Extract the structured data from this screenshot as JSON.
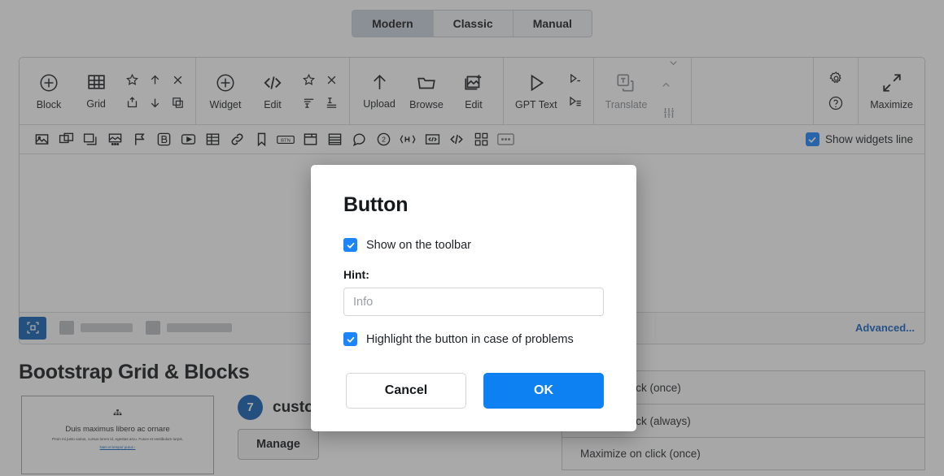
{
  "tabs": [
    {
      "label": "Modern",
      "active": true
    },
    {
      "label": "Classic",
      "active": false
    },
    {
      "label": "Manual",
      "active": false
    }
  ],
  "toolbar": {
    "groups": [
      {
        "name": "block-group",
        "buttons": [
          {
            "label": "Block",
            "icon": "plus-circle-icon"
          },
          {
            "label": "Grid",
            "icon": "grid-icon"
          }
        ],
        "mini": [
          {
            "icon": "star-icon",
            "disabled": false
          },
          {
            "icon": "arrow-up-icon",
            "disabled": false
          },
          {
            "icon": "close-x-icon",
            "disabled": false
          },
          {
            "icon": "insert-above-icon",
            "disabled": false
          },
          {
            "icon": "arrow-down-icon",
            "disabled": false
          },
          {
            "icon": "duplicate-icon",
            "disabled": false
          }
        ],
        "mini_cols": 3
      },
      {
        "name": "widget-group",
        "buttons": [
          {
            "label": "Widget",
            "icon": "plus-circle-icon"
          },
          {
            "label": "Edit",
            "icon": "code-icon"
          }
        ],
        "mini": [
          {
            "icon": "star-icon",
            "disabled": false
          },
          {
            "icon": "close-x-icon",
            "disabled": false
          },
          {
            "icon": "align-text-top-icon",
            "disabled": false
          },
          {
            "icon": "align-text-bottom-icon",
            "disabled": false
          }
        ],
        "mini_cols": 2
      },
      {
        "name": "image-group",
        "buttons": [
          {
            "label": "Upload",
            "icon": "upload-arrow-icon"
          },
          {
            "label": "Browse",
            "icon": "folder-icon"
          },
          {
            "label": "Edit",
            "icon": "image-edit-icon"
          }
        ],
        "mini": [],
        "mini_cols": 0
      },
      {
        "name": "gpt-group",
        "buttons": [
          {
            "label": "GPT Text",
            "icon": "play-triangle-icon"
          }
        ],
        "mini": [
          {
            "icon": "run-line-icon",
            "disabled": false
          },
          {
            "icon": "run-list-icon",
            "disabled": false
          }
        ],
        "mini_cols": 1
      },
      {
        "name": "translate-group",
        "buttons": [
          {
            "label": "Translate",
            "icon": "translate-icon",
            "disabled": true
          }
        ],
        "mini": [
          {
            "icon": "chevron-down-icon",
            "disabled": true
          },
          {
            "icon": "chevron-up-icon",
            "disabled": true
          },
          {
            "icon": "sliders-icon",
            "disabled": true
          }
        ],
        "mini_cols": 1
      }
    ],
    "right": {
      "settings_icon": "gear-icon",
      "help_icon": "question-circle-icon",
      "help_active": true,
      "maximize": {
        "label": "Maximize",
        "icon": "maximize-arrows-icon"
      }
    }
  },
  "widgets_line": {
    "icons": [
      "image-icon",
      "image-stack-icon",
      "image-multi-icon",
      "image-dots-icon",
      "flag-icon",
      "bold-box-icon",
      "video-play-icon",
      "table-icon",
      "link-icon",
      "bookmark-icon",
      "btn-icon",
      "window-icon",
      "rows-icon",
      "comment-icon",
      "number-two-icon",
      "heading-icon",
      "embed-code-icon",
      "code-tags-icon",
      "blocks-icon",
      "more-dots-icon"
    ],
    "toggle": {
      "label": "Show widgets line",
      "checked": true
    }
  },
  "statusbar": {
    "icon": "selection-target-icon",
    "advanced_label": "Advanced..."
  },
  "lower": {
    "section_title": "Bootstrap Grid & Blocks",
    "preview_card": {
      "glyph": "sitemap-icon",
      "heading": "Duis maximus libero ac ornare",
      "paragraph": "Proin mi justo varius, cursus lorem id, egestas arcu. Fusce et vestibulum turpis.",
      "link": "Nam et tempor purus ›"
    },
    "customizations": {
      "count": "7",
      "label": "customizations",
      "manage_label": "Manage"
    },
    "options": [
      "Open on click (once)",
      "Open on click (always)",
      "Maximize on click (once)"
    ]
  },
  "dialog": {
    "title": "Button",
    "show_on_toolbar": {
      "label": "Show on the toolbar",
      "checked": true
    },
    "hint": {
      "label": "Hint:",
      "value": "",
      "placeholder": "Info"
    },
    "highlight": {
      "label": "Highlight the button in case of problems",
      "checked": true
    },
    "cancel_label": "Cancel",
    "ok_label": "OK"
  },
  "colors": {
    "accent_blue": "#0d80f2",
    "checkbox_blue": "#1a85ff",
    "badge_blue": "#1160b4",
    "link_blue": "#1565c0",
    "overlay": "rgba(60,60,60,0.44)"
  }
}
